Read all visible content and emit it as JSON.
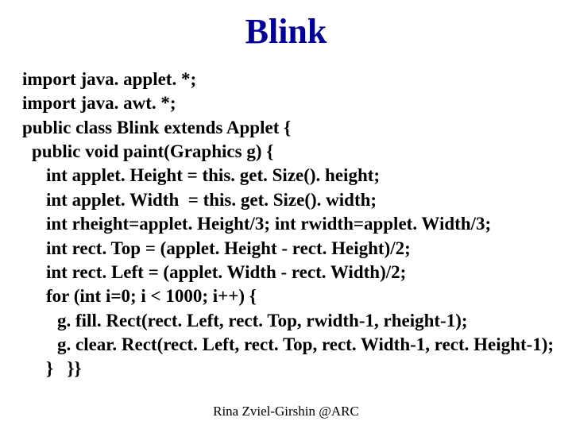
{
  "title": "Blink",
  "code": {
    "l1": "import java. applet. *;",
    "l2": "import java. awt. *;",
    "l3": "public class Blink extends Applet {",
    "l4": "public void paint(Graphics g) {",
    "l5": "int applet. Height = this. get. Size(). height;",
    "l6": "int applet. Width  = this. get. Size(). width;",
    "l7": "int rheight=applet. Height/3; int rwidth=applet. Width/3;",
    "l8": "int rect. Top = (applet. Height - rect. Height)/2;",
    "l9": "int rect. Left = (applet. Width - rect. Width)/2;",
    "l10": "for (int i=0; i < 1000; i++) {",
    "l11": "g. fill. Rect(rect. Left, rect. Top, rwidth-1, rheight-1);",
    "l12": "g. clear. Rect(rect. Left, rect. Top, rect. Width-1, rect. Height-1);",
    "l13": "}   }}"
  },
  "footer": "Rina Zviel-Girshin   @ARC"
}
